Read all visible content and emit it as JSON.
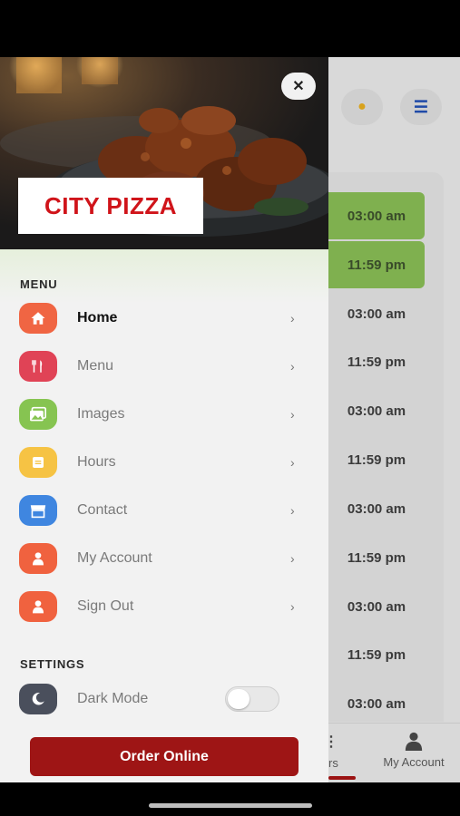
{
  "brand": {
    "logo_text": "CITY PIZZA"
  },
  "drawer": {
    "menu_section_label": "MENU",
    "items": [
      {
        "label": "Home",
        "icon": "home-icon",
        "color": "#f06543",
        "active": true
      },
      {
        "label": "Menu",
        "icon": "utensils-icon",
        "color": "#e04356",
        "active": false
      },
      {
        "label": "Images",
        "icon": "images-icon",
        "color": "#86c451",
        "active": false
      },
      {
        "label": "Hours",
        "icon": "clock-icon",
        "color": "#f6c344",
        "active": false
      },
      {
        "label": "Contact",
        "icon": "store-icon",
        "color": "#3f86e0",
        "active": false
      },
      {
        "label": "My Account",
        "icon": "user-icon",
        "color": "#f0623f",
        "active": false
      },
      {
        "label": "Sign Out",
        "icon": "user-icon",
        "color": "#f0623f",
        "active": false
      }
    ],
    "settings_section_label": "SETTINGS",
    "dark_mode": {
      "label": "Dark Mode",
      "icon": "moon-icon",
      "color": "#4a4f5c",
      "enabled": false
    },
    "order_button_label": "Order Online",
    "close_icon": "close-icon"
  },
  "background": {
    "hours_times": [
      "03:00 am",
      "11:59 pm",
      "03:00 am",
      "11:59 pm",
      "03:00 am",
      "11:59 pm",
      "03:00 am",
      "11:59 pm",
      "03:00 am",
      "11:59 pm",
      "03:00 am"
    ],
    "open_rows": 2,
    "tabbar": {
      "hours_label_partial": "rs",
      "account_label": "My Account"
    }
  },
  "colors": {
    "accent": "#9e1515",
    "open_green": "#7fb04f"
  }
}
